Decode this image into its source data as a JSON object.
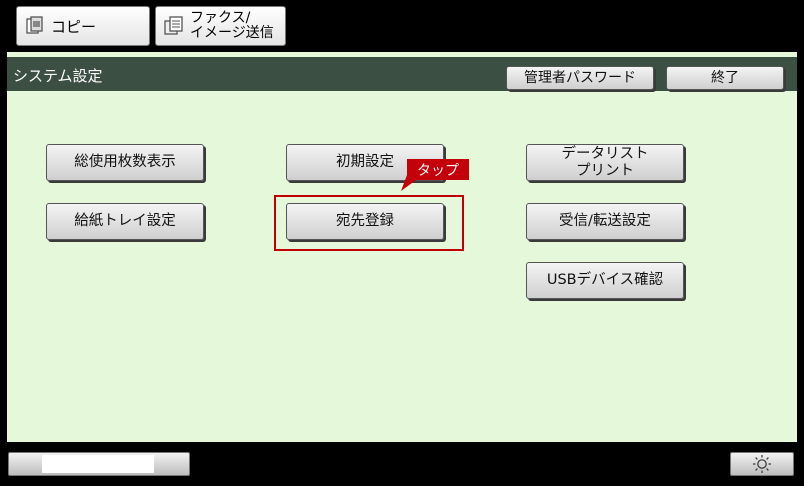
{
  "tabs": {
    "copy_label": "コピー",
    "fax_label_line1": "ファクス/",
    "fax_label_line2": "イメージ送信"
  },
  "header": {
    "title": "システム設定",
    "admin_password_label": "管理者パスワード",
    "end_label": "終了"
  },
  "buttons": {
    "total_count": "総使用枚数表示",
    "paper_tray": "給紙トレイ設定",
    "initial_settings": "初期設定",
    "address_registration": "宛先登録",
    "data_list_line1": "データリスト",
    "data_list_line2": "プリント",
    "receive_forward": "受信/転送設定",
    "usb_device": "USBデバイス確認"
  },
  "annotation": {
    "tap_label": "タップ",
    "highlight_color": "#c00000"
  },
  "colors": {
    "panel_bg": "#e6f8da",
    "titlebar_bg": "#3b4f43"
  }
}
